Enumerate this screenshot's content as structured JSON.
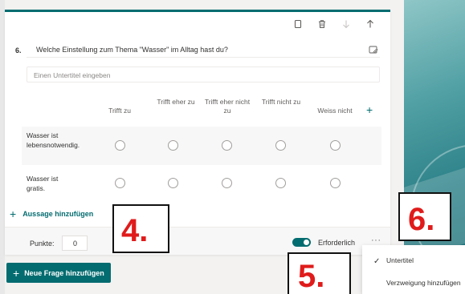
{
  "question": {
    "number": "6.",
    "title": "Welche Einstellung zum Thema \"Wasser\" im Alltag hast du?",
    "subtitle_placeholder": "Einen Untertitel eingeben"
  },
  "toolbar": {
    "icons": [
      "copy-icon",
      "delete-icon",
      "arrow-down-icon",
      "arrow-up-icon"
    ]
  },
  "columns": [
    "Trifft zu",
    "Trifft eher zu",
    "Trifft eher nicht zu",
    "Trifft nicht zu",
    "Weiss nicht"
  ],
  "statements": [
    "Wasser ist lebensnotwendig.",
    "Wasser ist gratis."
  ],
  "add_statement_label": "Aussage hinzufügen",
  "footer": {
    "points_label": "Punkte:",
    "points_value": "0",
    "required_label": "Erforderlich",
    "required_on": true,
    "more_label": "···"
  },
  "add_question_label": "Neue Frage hinzufügen",
  "menu": {
    "items": [
      {
        "label": "Untertitel",
        "checked": true
      },
      {
        "label": "Verzweigung hinzufügen",
        "checked": false
      }
    ]
  },
  "callouts": [
    "4.",
    "5.",
    "6."
  ],
  "colors": {
    "accent": "#036c70",
    "callout_red": "#e01b1b"
  }
}
